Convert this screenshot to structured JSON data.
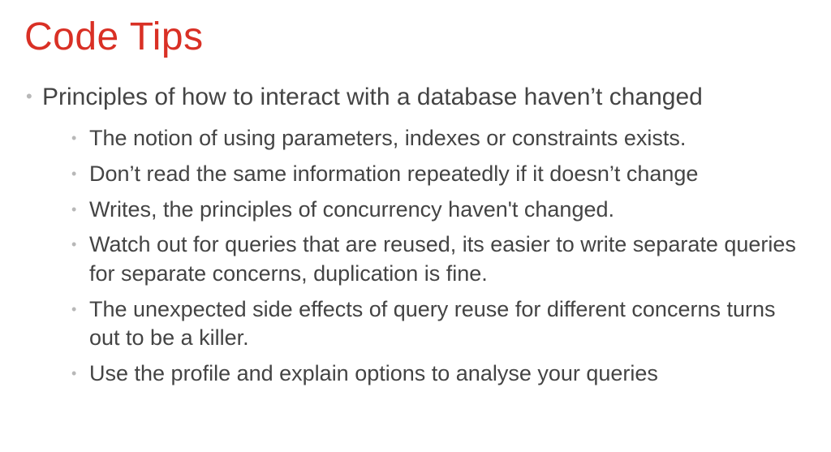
{
  "title": "Code Tips",
  "main_bullet": "Principles of how to interact with a database haven’t changed",
  "sub_bullets": [
    "The notion of using parameters, indexes or constraints exists.",
    "Don’t read the same information repeatedly if it doesn’t change",
    "Writes, the principles of concurrency haven't changed.",
    "Watch out for queries that are reused, its easier to write separate queries for separate concerns, duplication is fine.",
    "The unexpected side effects of query reuse for different concerns turns out to be a killer.",
    "Use the profile and explain options to analyse your queries"
  ]
}
